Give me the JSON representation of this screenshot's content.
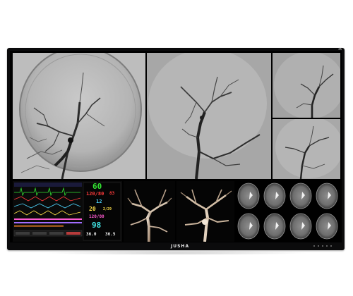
{
  "monitor": {
    "brand_logo": "JUSHA",
    "badge": "4K"
  },
  "vitals": {
    "hr": "60",
    "bp_main": "120/80",
    "bp_small": "83",
    "rr": "12",
    "temp_pair": "20",
    "temp_pair_small": "2/29",
    "nibp": "120/80",
    "spo2": "98",
    "temp1": "36.0",
    "temp2": "36.5",
    "colors": {
      "hr": "#33e233",
      "bp": "#ff3b3b",
      "rr": "#4fd6ff",
      "temp": "#ffe14a",
      "spo2": "#42e6e6",
      "nibp": "#ff5bd1"
    }
  }
}
